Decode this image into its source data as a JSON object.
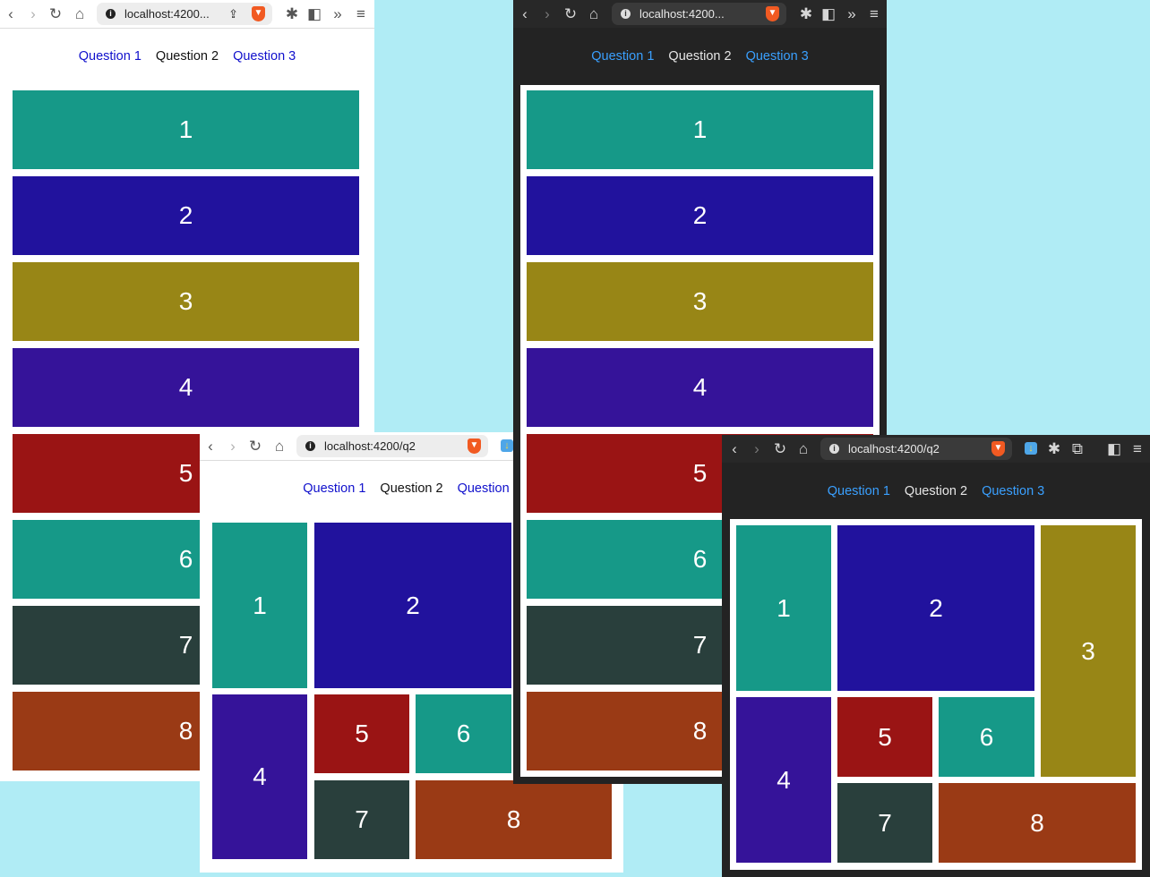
{
  "url_short": "localhost:4200...",
  "url_full": "localhost:4200/q2",
  "nav": [
    "Question 1",
    "Question 2",
    "Question 3"
  ],
  "tiles": [
    "1",
    "2",
    "3",
    "4",
    "5",
    "6",
    "7",
    "8"
  ],
  "tile_colors": [
    "#169988",
    "#21129d",
    "#988616",
    "#351399",
    "#9a1414",
    "#169988",
    "#293f3c",
    "#9a3a15"
  ],
  "icons": [
    "back-icon",
    "forward-icon",
    "reload-icon",
    "home-icon",
    "info-icon",
    "share-icon",
    "brave-lion-icon",
    "extensions-icon",
    "sidebar-icon",
    "more-icon",
    "menu-icon",
    "download-icon",
    "screenshot-icon"
  ]
}
